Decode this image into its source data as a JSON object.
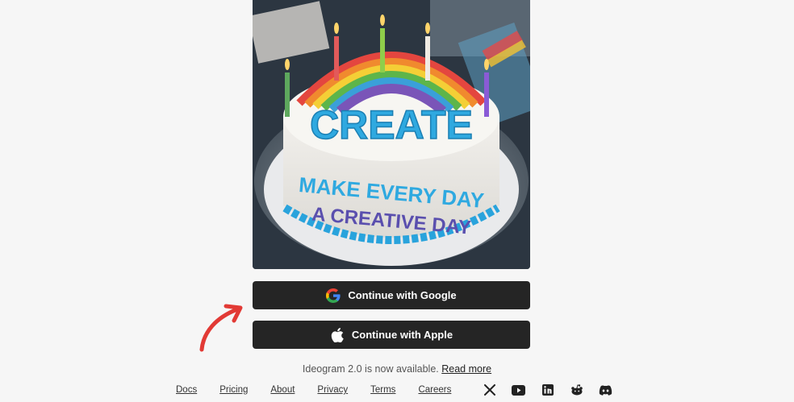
{
  "hero": {
    "cake_title": "CREATE",
    "cake_line1": "MAKE EVERY DAY",
    "cake_line2": "A CREATIVE DAY"
  },
  "auth": {
    "google_label": "Continue with Google",
    "apple_label": "Continue with Apple"
  },
  "announcement": {
    "text": "Ideogram 2.0 is now available.",
    "link": "Read more"
  },
  "footer": {
    "links": [
      "Docs",
      "Pricing",
      "About",
      "Privacy",
      "Terms",
      "Careers"
    ],
    "social_icons": [
      "x-icon",
      "youtube-icon",
      "linkedin-icon",
      "reddit-icon",
      "discord-icon"
    ]
  },
  "colors": {
    "page_bg": "#f6f6f6",
    "button_bg": "#252525",
    "button_text": "#ffffff",
    "arrow": "#e23a35"
  }
}
